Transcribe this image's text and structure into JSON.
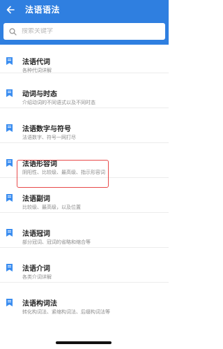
{
  "header": {
    "title": "法语语法",
    "back_icon": "arrow-left-icon"
  },
  "search": {
    "placeholder": "搜索关键字",
    "value": "",
    "icon": "search-icon"
  },
  "colors": {
    "accent": "#2f7fe0",
    "highlight": "#e84a4a",
    "item_icon": "#3a8df0"
  },
  "list": {
    "items": [
      {
        "title": "法语代词",
        "subtitle": "各种代词详解"
      },
      {
        "title": "动词与时态",
        "subtitle": "介绍动词的不同语式以及不同时态"
      },
      {
        "title": "法语数字与符号",
        "subtitle": "法语数字、符号一网打尽"
      },
      {
        "title": "法语形容词",
        "subtitle": "阴阳性、比较级、最高级、指示形容词"
      },
      {
        "title": "法语副词",
        "subtitle": "比较级、最高级，以及位置"
      },
      {
        "title": "法语冠词",
        "subtitle": "部分冠词、冠词的省略和缩合等"
      },
      {
        "title": "法语介词",
        "subtitle": "各类介词详解"
      },
      {
        "title": "法语构词法",
        "subtitle": "转化构词法、紧缩构词法、后缀构词法等"
      }
    ]
  }
}
